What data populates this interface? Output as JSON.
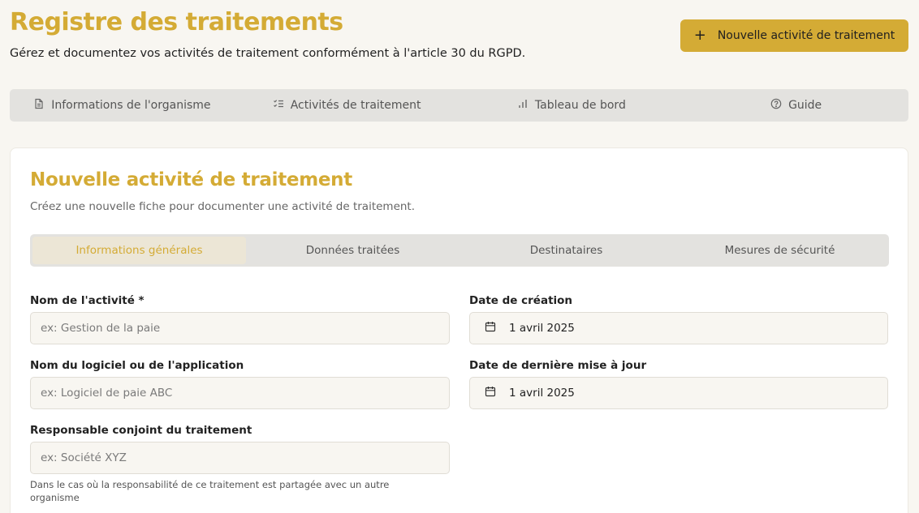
{
  "header": {
    "title": "Registre des traitements",
    "subtitle": "Gérez et documentez vos activités de traitement conformément à l'article 30 du RGPD.",
    "new_button": "Nouvelle activité de traitement"
  },
  "main_tabs": [
    {
      "label": "Informations de l'organisme",
      "icon": "document-icon"
    },
    {
      "label": "Activités de traitement",
      "icon": "checklist-icon"
    },
    {
      "label": "Tableau de bord",
      "icon": "bar-chart-icon"
    },
    {
      "label": "Guide",
      "icon": "help-circle-icon"
    }
  ],
  "form": {
    "title": "Nouvelle activité de traitement",
    "subtitle": "Créez une nouvelle fiche pour documenter une activité de traitement.",
    "tabs": [
      {
        "label": "Informations générales",
        "active": true
      },
      {
        "label": "Données traitées",
        "active": false
      },
      {
        "label": "Destinataires",
        "active": false
      },
      {
        "label": "Mesures de sécurité",
        "active": false
      }
    ],
    "activity_name": {
      "label": "Nom de l'activité *",
      "placeholder": "ex: Gestion de la paie",
      "value": ""
    },
    "software_name": {
      "label": "Nom du logiciel ou de l'application",
      "placeholder": "ex: Logiciel de paie ABC",
      "value": ""
    },
    "joint_controller": {
      "label": "Responsable conjoint du traitement",
      "placeholder": "ex: Société XYZ",
      "value": "",
      "help": "Dans le cas où la responsabilité de ce traitement est partagée avec un autre organisme"
    },
    "creation_date": {
      "label": "Date de création",
      "value": "1 avril 2025"
    },
    "update_date": {
      "label": "Date de dernière mise à jour",
      "value": "1 avril 2025"
    }
  },
  "colors": {
    "accent": "#d4ab35",
    "background": "#f8f6f1",
    "tab_bar": "#e3e2df",
    "active_tab": "#ece6d6"
  }
}
